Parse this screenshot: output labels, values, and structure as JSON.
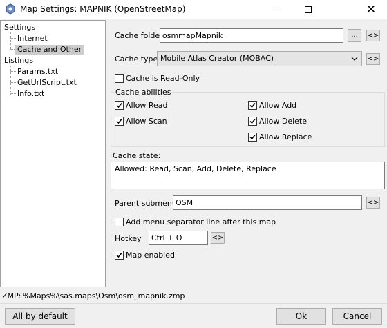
{
  "window": {
    "title": "Map Settings: MAPNIK (OpenStreetMap)"
  },
  "icons": {
    "app": "globe-settings-icon",
    "minimize": "minimize-icon",
    "maximize": "maximize-icon",
    "close": "close-icon"
  },
  "tree": {
    "settings": "Settings",
    "internet": "Internet",
    "cache_and_other": "Cache and Other",
    "listings": "Listings",
    "params": "Params.txt",
    "geturlscript": "GetUrlScript.txt",
    "info": "Info.txt"
  },
  "cache_folder": {
    "label": "Cache folder",
    "value": "osmmapMapnik",
    "browse_label": "...",
    "reset_label": "<>"
  },
  "cache_type": {
    "label": "Cache type",
    "selected": "Mobile Atlas Creator (MOBAC)",
    "reset_label": "<>"
  },
  "cache_readonly": {
    "label": "Cache is Read-Only",
    "checked": false
  },
  "cache_abilities": {
    "title": "Cache abilities",
    "allow_read": {
      "label": "Allow Read",
      "checked": true
    },
    "allow_scan": {
      "label": "Allow Scan",
      "checked": true
    },
    "allow_add": {
      "label": "Allow Add",
      "checked": true
    },
    "allow_delete": {
      "label": "Allow Delete",
      "checked": true
    },
    "allow_replace": {
      "label": "Allow Replace",
      "checked": true
    }
  },
  "cache_state": {
    "label": "Cache state:",
    "value": "Allowed: Read, Scan, Add, Delete, Replace"
  },
  "parent_submenu": {
    "label": "Parent submenu",
    "value": "OSM",
    "reset_label": "<>"
  },
  "menu_separator": {
    "label": "Add menu separator line after this map",
    "checked": false
  },
  "hotkey": {
    "label": "Hotkey",
    "value": "Ctrl + O",
    "reset_label": "<>"
  },
  "map_enabled": {
    "label": "Map enabled",
    "checked": true
  },
  "zmp": {
    "label": "ZMP:",
    "path": "%Maps%\\sas.maps\\Osm\\osm_mapnik.zmp"
  },
  "buttons": {
    "all_by_default": "All by default",
    "ok": "Ok",
    "cancel": "Cancel"
  }
}
